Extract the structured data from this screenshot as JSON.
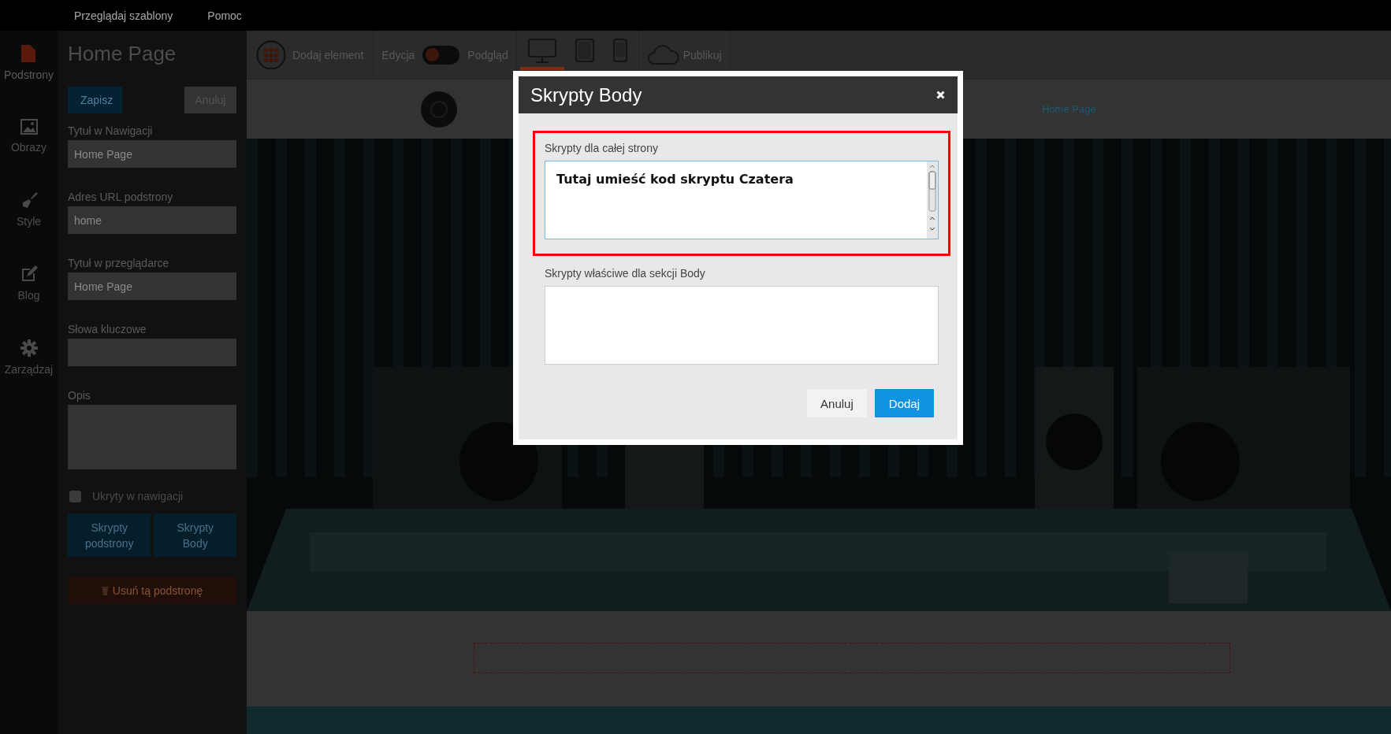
{
  "top_menu": [
    {
      "label": "Przeglądaj szablony"
    },
    {
      "label": "Pomoc"
    }
  ],
  "rail": [
    {
      "label": "Podstrony",
      "selected": true
    },
    {
      "label": "Obrazy",
      "selected": false
    },
    {
      "label": "Style",
      "selected": false
    },
    {
      "label": "Blog",
      "selected": false
    },
    {
      "label": "Zarządzaj",
      "selected": false
    }
  ],
  "page_panel": {
    "title": "Home Page",
    "save": "Zapisz",
    "cancel": "Anuluj",
    "fields": [
      {
        "label": "Tytuł w Nawigacji",
        "value": "Home Page",
        "kind": "input"
      },
      {
        "label": "Adres URL podstrony",
        "value": "home",
        "kind": "input"
      },
      {
        "label": "Tytuł w przeglądarce",
        "value": "Home Page",
        "kind": "input"
      },
      {
        "label": "Słowa kluczowe",
        "kind": "input"
      },
      {
        "label": "Opis",
        "kind": "textarea"
      }
    ],
    "hidden_checkbox": {
      "label": "Ukryty w nawigacji",
      "checked": false
    },
    "script_buttons": [
      "Skrypty podstrony",
      "Skrypty Body"
    ],
    "delete": "Usuń tą podstronę"
  },
  "toolbar": {
    "add_element": "Dodaj element",
    "mode_left": "Edycja",
    "mode_toggle": {
      "on": false
    },
    "mode_right": "Podgląd",
    "devices": [
      {
        "kind": "desktop",
        "selected": true
      },
      {
        "kind": "tablet",
        "selected": false
      },
      {
        "kind": "phone",
        "selected": false
      }
    ],
    "publish": "Publikuj"
  },
  "site_header": {
    "nav_link": "Home Page"
  },
  "modal": {
    "title": "Skrypty Body",
    "sections": [
      {
        "label": "Skrypty dla całej strony",
        "value": "Tutaj umieść kod skryptu Czatera",
        "highlighted": true
      },
      {
        "label": "Skrypty właściwe dla sekcji Body",
        "highlighted": false
      }
    ],
    "cancel": "Anuluj",
    "confirm": "Dodaj"
  }
}
